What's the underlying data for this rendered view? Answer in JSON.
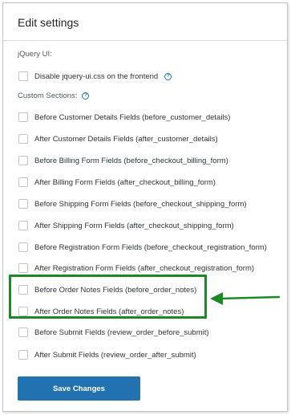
{
  "panel": {
    "title": "Edit settings"
  },
  "jquery_ui": {
    "label": "jQuery UI:",
    "disable_css_label": "Disable jquery-ui.css on the frontend",
    "help_icon": "help-circle-icon"
  },
  "custom_sections": {
    "label": "Custom Sections:",
    "help_icon": "help-circle-icon",
    "items": [
      {
        "label": "Before Customer Details Fields (before_customer_details)",
        "checked": false
      },
      {
        "label": "After Customer Details Fields (after_customer_details)",
        "checked": false
      },
      {
        "label": "Before Billing Form Fields (before_checkout_billing_form)",
        "checked": false
      },
      {
        "label": "After Billing Form Fields (after_checkout_billing_form)",
        "checked": false
      },
      {
        "label": "Before Shipping Form Fields (before_checkout_shipping_form)",
        "checked": false
      },
      {
        "label": "After Shipping Form Fields (after_checkout_shipping_form)",
        "checked": false
      },
      {
        "label": "Before Registration Form Fields (before_checkout_registration_form)",
        "checked": false
      },
      {
        "label": "After Registration Form Fields (after_checkout_registration_form)",
        "checked": false
      },
      {
        "label": "Before Order Notes Fields (before_order_notes)",
        "checked": false
      },
      {
        "label": "After Order Notes Fields (after_order_notes)",
        "checked": false
      },
      {
        "label": "Before Submit Fields (review_order_before_submit)",
        "checked": false
      },
      {
        "label": "After Submit Fields (review_order_after_submit)",
        "checked": false
      }
    ]
  },
  "save_button": {
    "label": "Save Changes"
  },
  "colors": {
    "primary": "#2271b1",
    "highlight": "#1b8a24"
  }
}
